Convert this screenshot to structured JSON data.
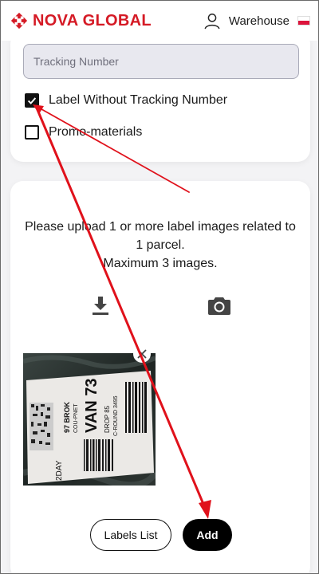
{
  "header": {
    "logo_text": "NOVA GLOBAL",
    "brand_color": "#d51a25",
    "user_icon": "user-icon",
    "warehouse_label": "Warehouse",
    "language_flag": "poland-flag"
  },
  "form": {
    "tracking_placeholder": "Tracking Number",
    "options": [
      {
        "label": "Label Without Tracking Number",
        "checked": true
      },
      {
        "label": "Promo-materials",
        "checked": false
      }
    ]
  },
  "upload": {
    "instruction_line1": "Please upload 1 or more label images related to 1 parcel.",
    "instruction_line2": "Maximum 3 images.",
    "download_icon": "download-icon",
    "camera_icon": "camera-icon"
  },
  "thumbnail": {
    "label_lines": [
      "97 BROK",
      "COU-PNET",
      "VAN 73",
      "DROP 85",
      "C-ROUND 3495",
      "2DAY"
    ],
    "close_icon": "close-icon"
  },
  "actions": {
    "labels_list": "Labels List",
    "add": "Add"
  },
  "annotation": {
    "arrow_color": "#e0111b"
  }
}
